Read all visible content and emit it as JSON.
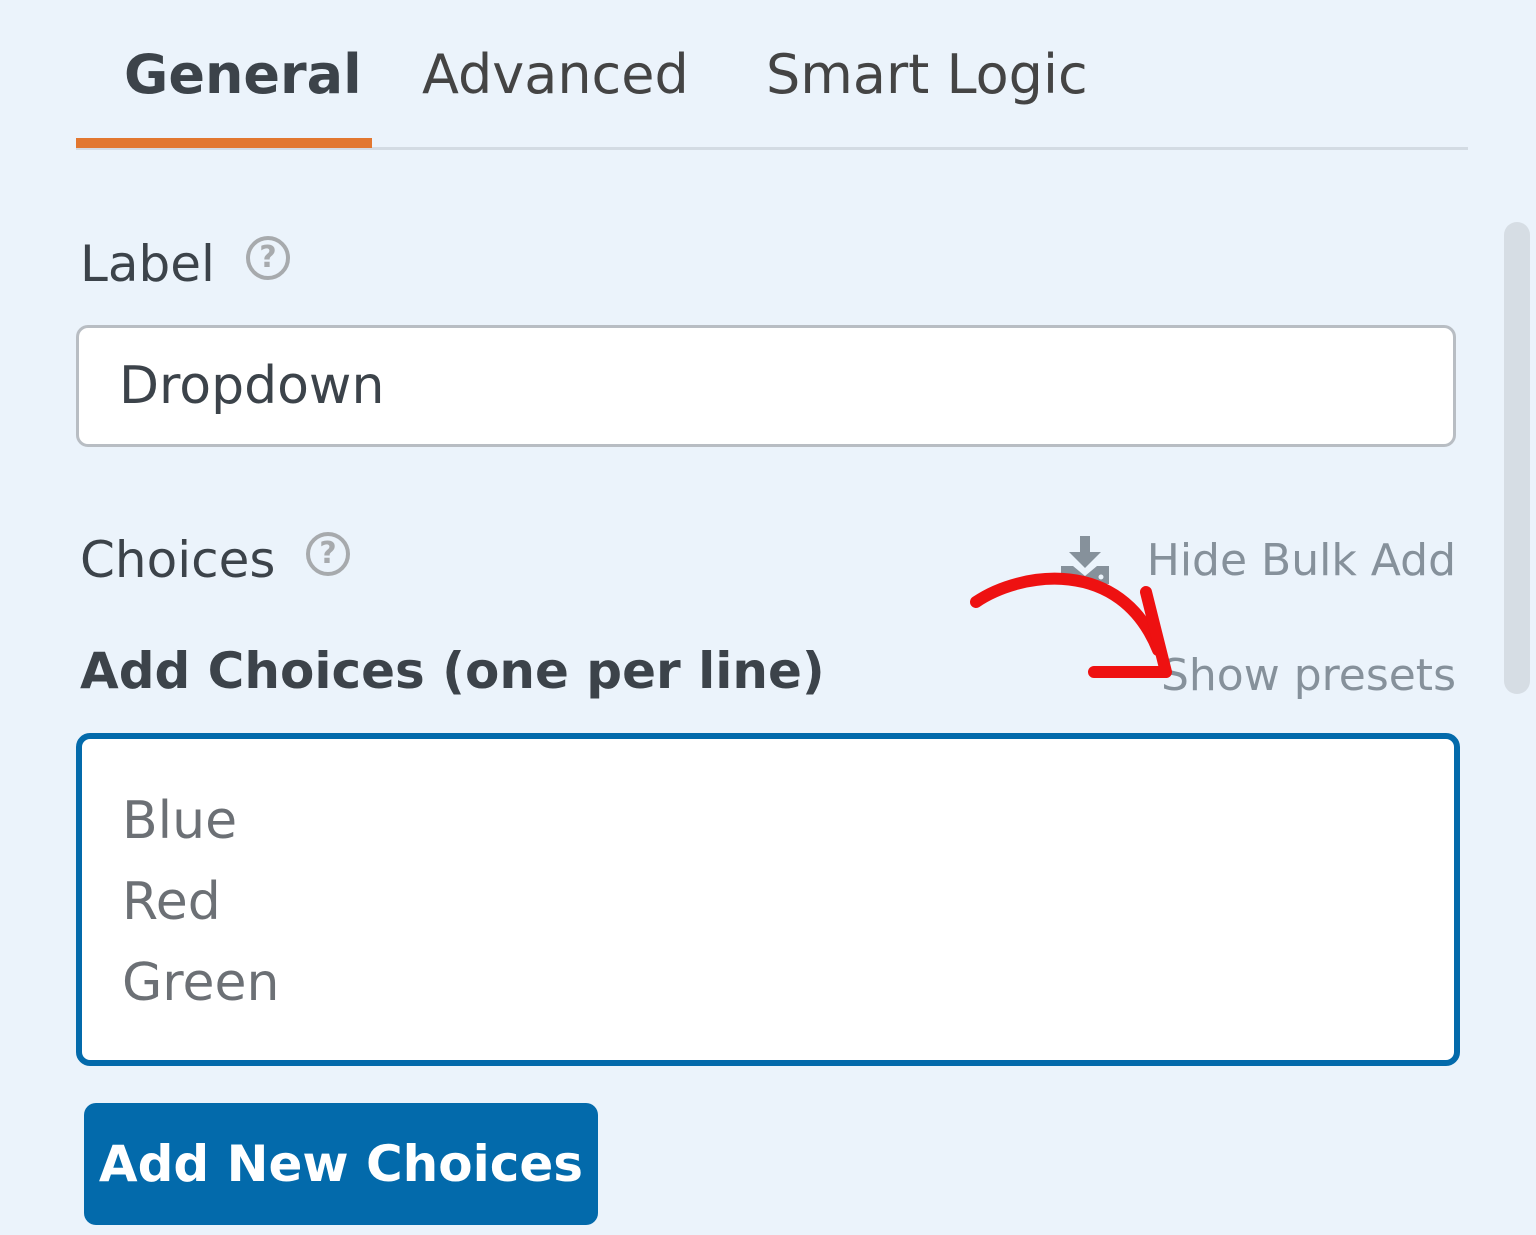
{
  "tabs": [
    {
      "label": "General",
      "active": true
    },
    {
      "label": "Advanced",
      "active": false
    },
    {
      "label": "Smart Logic",
      "active": false
    }
  ],
  "label_field": {
    "label": "Label",
    "value": "Dropdown"
  },
  "choices": {
    "label": "Choices",
    "bulk_toggle": "Hide Bulk Add",
    "bulk_icon": "download-icon",
    "add_label": "Add Choices (one per line)",
    "presets_link": "Show presets",
    "lines": [
      "Blue",
      "Red",
      "Green"
    ],
    "add_button": "Add New Choices"
  },
  "colors": {
    "accent_tab": "#e27730",
    "primary": "#036aab",
    "background": "#ebf3fb",
    "annotation": "#ee1111"
  }
}
